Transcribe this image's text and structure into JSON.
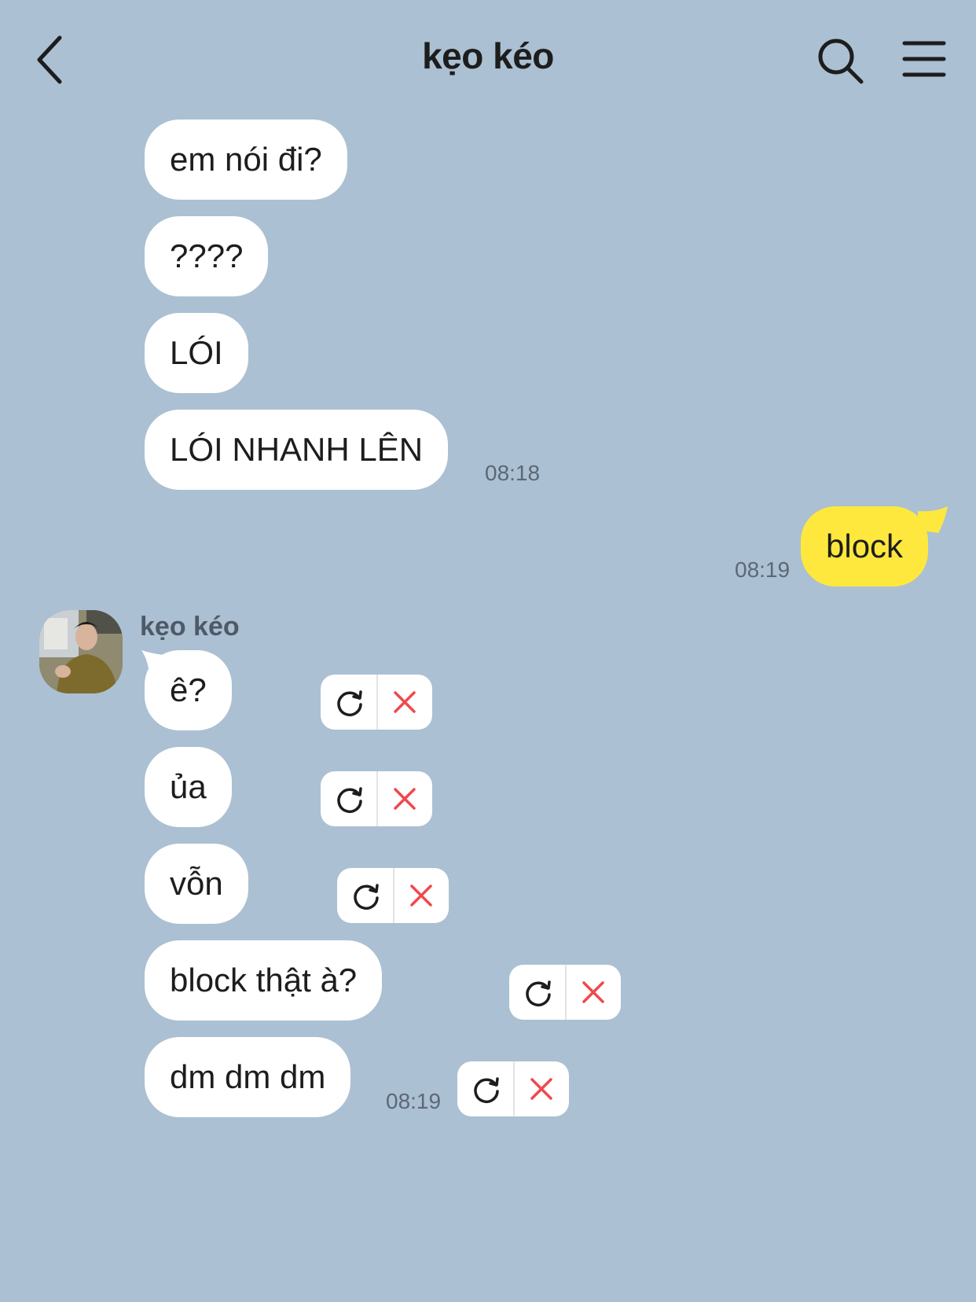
{
  "header": {
    "title": "kẹo kéo"
  },
  "messages": [
    {
      "text": "em nói đi?"
    },
    {
      "text": "????"
    },
    {
      "text": "LÓI"
    },
    {
      "text": "LÓI NHANH LÊN",
      "time": "08:18"
    },
    {
      "text": "block",
      "time": "08:19",
      "from_me": true
    },
    {
      "text": "ê?",
      "status": "failed"
    },
    {
      "text": "ủa",
      "status": "failed"
    },
    {
      "text": "vỗn",
      "status": "failed"
    },
    {
      "text": "block thật à?",
      "status": "failed"
    },
    {
      "text": "dm dm dm",
      "time": "08:19",
      "status": "failed"
    }
  ],
  "sender_name": "kẹo kéo",
  "colors": {
    "background": "#abc0d2",
    "my_bubble": "#fee83d",
    "their_bubble": "#ffffff",
    "cancel_x": "#f0484c"
  },
  "icons": [
    "back-arrow-icon",
    "search-icon",
    "menu-icon",
    "resend-icon",
    "cancel-icon"
  ]
}
